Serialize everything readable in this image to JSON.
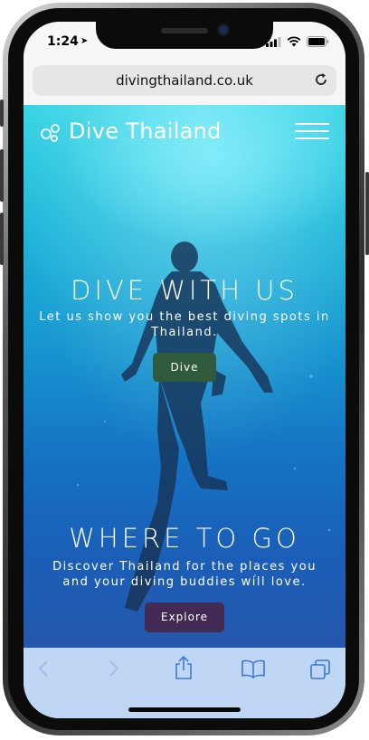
{
  "status_bar": {
    "time": "1:24"
  },
  "browser": {
    "url": "divingthailand.co.uk"
  },
  "site": {
    "brand": "Dive Thailand"
  },
  "sections": [
    {
      "heading": "DIVE WITH US",
      "text": "Let us show you the best diving spots in Thailand.",
      "button_label": "Dive",
      "button_color": "#2f5a3c"
    },
    {
      "heading": "WHERE TO GO",
      "text": "Discover Thailand for the places you and your diving buddies will love.",
      "button_label": "Explore",
      "button_color": "#432a55"
    }
  ],
  "icons": {
    "logo": "bubbles-logo-icon",
    "menu": "hamburger-menu-icon",
    "reload": "reload-icon",
    "back": "chevron-left-icon",
    "forward": "chevron-right-icon",
    "share": "share-icon",
    "bookmarks": "book-icon",
    "tabs": "tabs-icon"
  },
  "colors": {
    "toolbar_bg": "#bfd6f5",
    "water_top": "#33d3e3",
    "water_bottom": "#2558ad"
  }
}
